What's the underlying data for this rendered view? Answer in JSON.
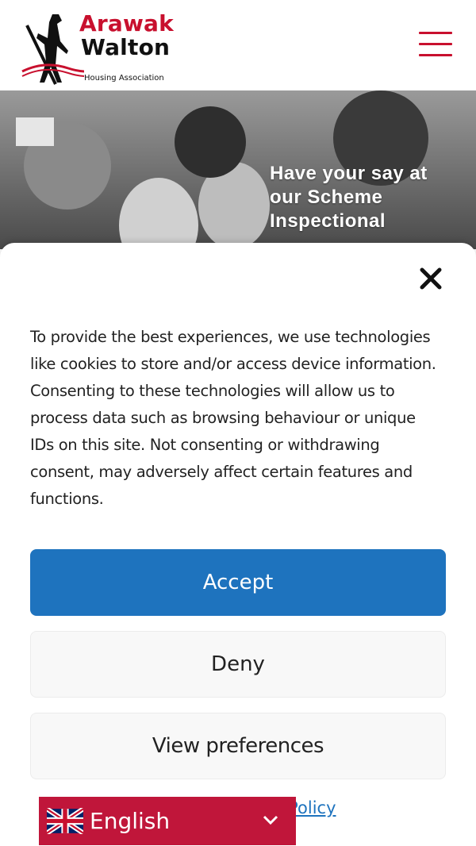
{
  "header": {
    "logo_line1": "Arawak",
    "logo_line2": "Walton",
    "logo_subtitle": "Housing Association",
    "brand_color": "#c8102e"
  },
  "hero": {
    "title": "Have your say at our Scheme Inspectional"
  },
  "consent": {
    "message": "To provide the best experiences, we use technologies like cookies to store and/or access device information. Consenting to these technologies will allow us to process data such as browsing behaviour or unique IDs on this site. Not consenting or withdrawing consent, may adversely affect certain features and functions.",
    "accept_label": "Accept",
    "deny_label": "Deny",
    "preferences_label": "View preferences",
    "policy_link_partial": "y Policy",
    "accent_color": "#1e73be"
  },
  "language": {
    "flag": "uk-flag-icon",
    "current": "English",
    "bar_color": "#c0163a"
  }
}
